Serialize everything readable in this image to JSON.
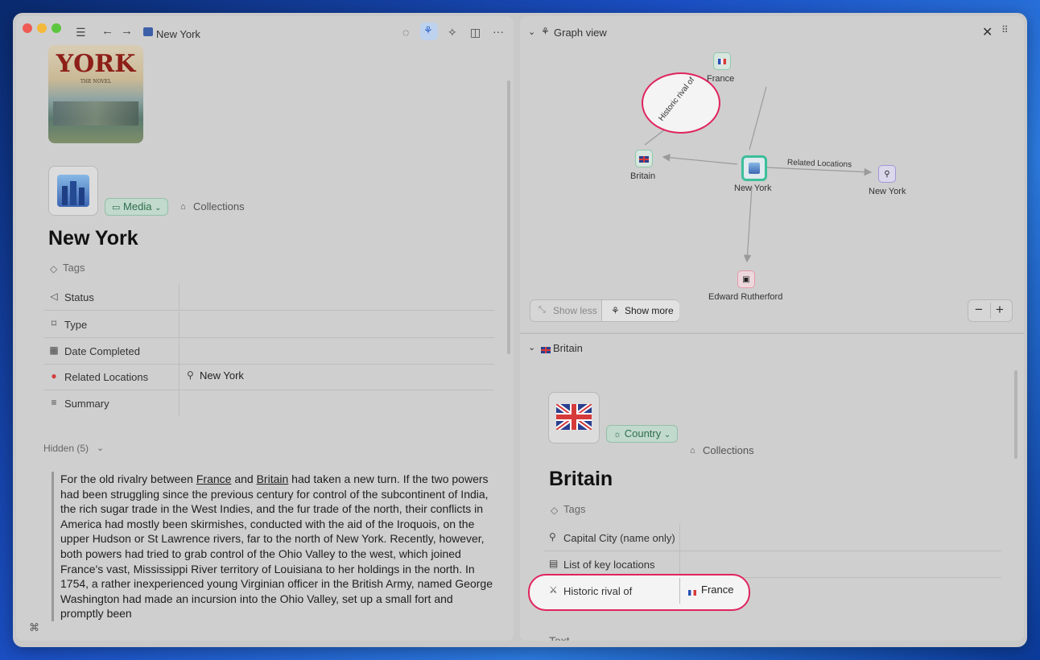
{
  "left": {
    "toolbar": {
      "title": "New York"
    },
    "cover": {
      "line1": "YORK",
      "line2": "THE NOVEL"
    },
    "page": {
      "type_label": "Media",
      "collections_label": "Collections",
      "title": "New York",
      "tags_label": "Tags",
      "properties": [
        {
          "label": "Status",
          "value": ""
        },
        {
          "label": "Type",
          "value": ""
        },
        {
          "label": "Date Completed",
          "value": ""
        },
        {
          "label": "Related Locations",
          "value": "New York"
        },
        {
          "label": "Summary",
          "value": ""
        }
      ],
      "hidden_label": "Hidden (5)",
      "body": {
        "p1": "For the old rivalry between ",
        "link1": "France",
        "p2": " and ",
        "link2": "Britain",
        "p3": " had taken a new turn. If the two powers had been struggling since the previous century for control of the subcontinent of India, the rich sugar trade in the West Indies, and the fur trade of the north, their conflicts in America had mostly been skirmishes, conducted with the aid of the Iroquois, on the upper Hudson or St Lawrence rivers, far to the north of New York. Recently, however, both powers had tried to grab control of the Ohio Valley to the west, which joined France's vast, Mississippi River territory of Louisiana to her holdings in the north. In 1754, a rather inexperienced young Virginian officer in the British Army, named George Washington had made an incursion into the Ohio Valley, set up a small fort and promptly been"
      }
    }
  },
  "graph": {
    "header": "Graph view",
    "nodes": {
      "france": "France",
      "britain": "Britain",
      "newyork_center": "New York",
      "newyork_right": "New York",
      "rutherford": "Edward Rutherford"
    },
    "edges": {
      "related": "Related Locations",
      "rival": "Historic rival of"
    },
    "show_less": "Show less",
    "show_more": "Show more"
  },
  "detail": {
    "header": "Britain",
    "type_label": "Country",
    "collections_label": "Collections",
    "title": "Britain",
    "tags_label": "Tags",
    "properties": [
      {
        "label": "Capital City (name only)",
        "value": ""
      },
      {
        "label": "List of key locations",
        "value": ""
      },
      {
        "label": "Historic rival of",
        "value": "France"
      }
    ],
    "text_label": "Text"
  },
  "colors": {
    "accent": "#e0245e",
    "pill_green": "#2d6e4b",
    "node_center": "#3cbf9a"
  }
}
